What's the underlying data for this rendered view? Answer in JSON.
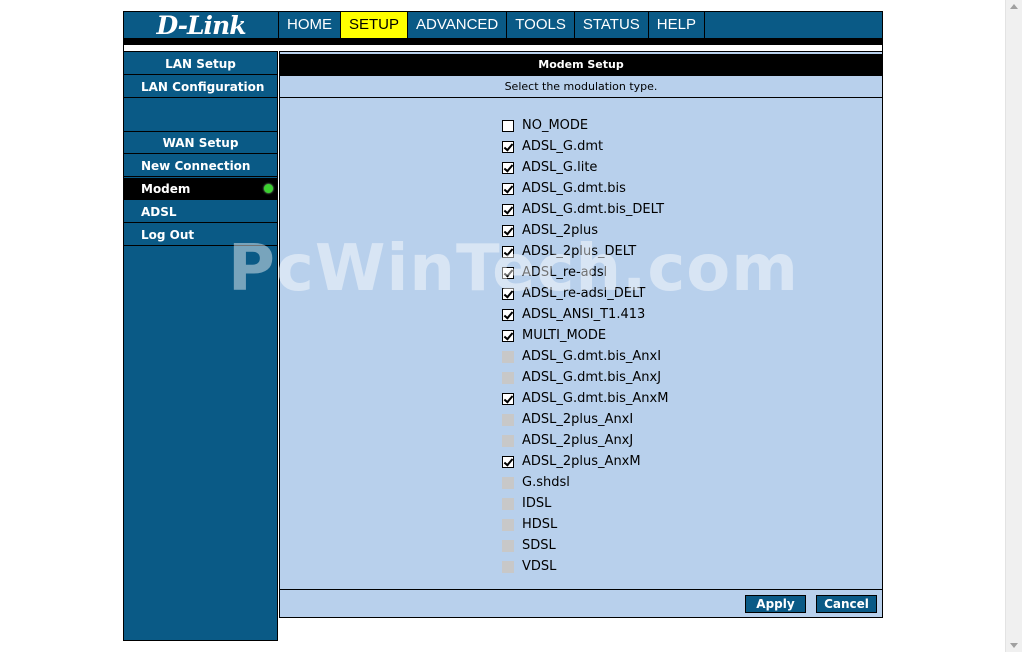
{
  "brand": {
    "logo_text": "D-Link"
  },
  "topnav": [
    {
      "label": "HOME",
      "active": false
    },
    {
      "label": "SETUP",
      "active": true
    },
    {
      "label": "ADVANCED",
      "active": false
    },
    {
      "label": "TOOLS",
      "active": false
    },
    {
      "label": "STATUS",
      "active": false
    },
    {
      "label": "HELP",
      "active": false
    }
  ],
  "sidebar": {
    "lan_header": "LAN Setup",
    "lan_configuration": "LAN Configuration",
    "wan_header": "WAN Setup",
    "new_connection": "New Connection",
    "modem": "Modem",
    "adsl": "ADSL",
    "log_out": "Log Out"
  },
  "main": {
    "title": "Modem Setup",
    "subtitle": "Select the modulation type."
  },
  "modes": [
    {
      "label": "NO_MODE",
      "state": "unchecked"
    },
    {
      "label": "ADSL_G.dmt",
      "state": "checked"
    },
    {
      "label": "ADSL_G.lite",
      "state": "checked"
    },
    {
      "label": "ADSL_G.dmt.bis",
      "state": "checked"
    },
    {
      "label": "ADSL_G.dmt.bis_DELT",
      "state": "checked"
    },
    {
      "label": "ADSL_2plus",
      "state": "checked"
    },
    {
      "label": "ADSL_2plus_DELT",
      "state": "checked"
    },
    {
      "label": "ADSL_re-adsl",
      "state": "checked"
    },
    {
      "label": "ADSL_re-adsl_DELT",
      "state": "checked"
    },
    {
      "label": "ADSL_ANSI_T1.413",
      "state": "checked"
    },
    {
      "label": "MULTI_MODE",
      "state": "checked"
    },
    {
      "label": "ADSL_G.dmt.bis_AnxI",
      "state": "disabled"
    },
    {
      "label": "ADSL_G.dmt.bis_AnxJ",
      "state": "disabled"
    },
    {
      "label": "ADSL_G.dmt.bis_AnxM",
      "state": "checked"
    },
    {
      "label": "ADSL_2plus_AnxI",
      "state": "disabled"
    },
    {
      "label": "ADSL_2plus_AnxJ",
      "state": "disabled"
    },
    {
      "label": "ADSL_2plus_AnxM",
      "state": "checked"
    },
    {
      "label": "G.shdsl",
      "state": "disabled"
    },
    {
      "label": "IDSL",
      "state": "disabled"
    },
    {
      "label": "HDSL",
      "state": "disabled"
    },
    {
      "label": "SDSL",
      "state": "disabled"
    },
    {
      "label": "VDSL",
      "state": "disabled"
    }
  ],
  "buttons": {
    "apply": "Apply",
    "cancel": "Cancel"
  },
  "watermark": "PcWinTech.com",
  "colors": {
    "nav_blue": "#0a5a86",
    "panel_blue": "#b8d0ec",
    "active_tab": "#ffff00",
    "status_dot": "#3bd12f"
  }
}
